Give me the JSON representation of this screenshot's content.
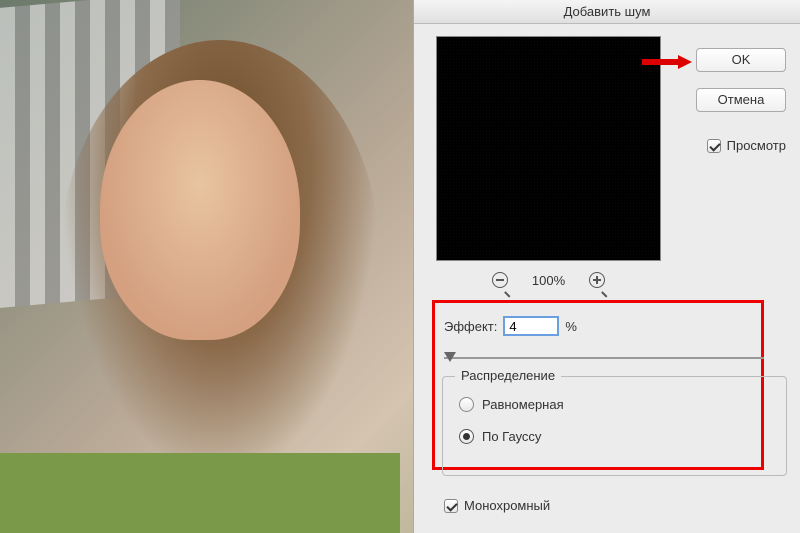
{
  "dialog": {
    "title": "Добавить шум",
    "ok_label": "OK",
    "cancel_label": "Отмена",
    "preview_checkbox": "Просмотр",
    "preview_checked": true,
    "zoom_level": "100%"
  },
  "effect": {
    "label": "Эффект:",
    "value": "4",
    "unit": "%"
  },
  "distribution": {
    "legend": "Распределение",
    "uniform_label": "Равномерная",
    "gaussian_label": "По Гауссу",
    "selected": "gaussian"
  },
  "monochrome": {
    "label": "Монохромный",
    "checked": true
  }
}
